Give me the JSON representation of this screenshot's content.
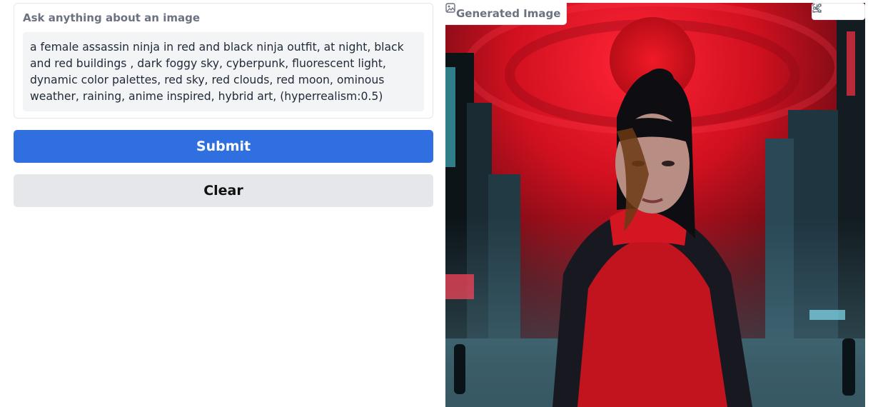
{
  "prompt": {
    "label": "Ask anything about an image",
    "value": "a female assassin ninja in red and black ninja outfit, at night, black and red buildings , dark foggy sky, cyberpunk, fluorescent light, dynamic color palettes, red sky, red clouds, red moon, ominous weather, raining, anime inspired, hybrid art, (hyperrealism:0.5)"
  },
  "buttons": {
    "submit_label": "Submit",
    "clear_label": "Clear"
  },
  "output": {
    "label": "Generated Image",
    "toolbar": [
      "fullscreen-icon",
      "download-icon",
      "share-icon"
    ]
  },
  "colors": {
    "submit": "#2f6fe0",
    "clear": "#e5e7eb",
    "label": "#6b7280"
  }
}
